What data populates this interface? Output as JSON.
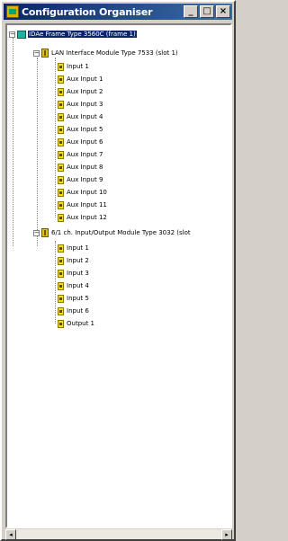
{
  "window": {
    "title": "Configuration Organiser",
    "minimize": "_",
    "maximize": "□",
    "close": "×"
  },
  "tree": {
    "root": {
      "label": "IDAe Frame Type 3560C (frame 1)",
      "toggle": "−"
    },
    "modules": [
      {
        "label": "LAN Interface Module Type 7533 (slot 1)",
        "toggle": "−",
        "children": [
          "Input 1",
          "Aux Input 1",
          "Aux Input 2",
          "Aux Input 3",
          "Aux Input 4",
          "Aux Input 5",
          "Aux Input 6",
          "Aux Input 7",
          "Aux Input 8",
          "Aux Input 9",
          "Aux Input 10",
          "Aux Input 11",
          "Aux Input 12"
        ]
      },
      {
        "label": "6/1 ch. Input/Output Module Type 3032 (slot",
        "toggle": "−",
        "children": [
          "Input 1",
          "Input 2",
          "Input 3",
          "Input 4",
          "Input 5",
          "Input 6",
          "Output 1"
        ]
      }
    ]
  },
  "scrollbar": {
    "left_arrow": "◂",
    "right_arrow": "▸"
  }
}
